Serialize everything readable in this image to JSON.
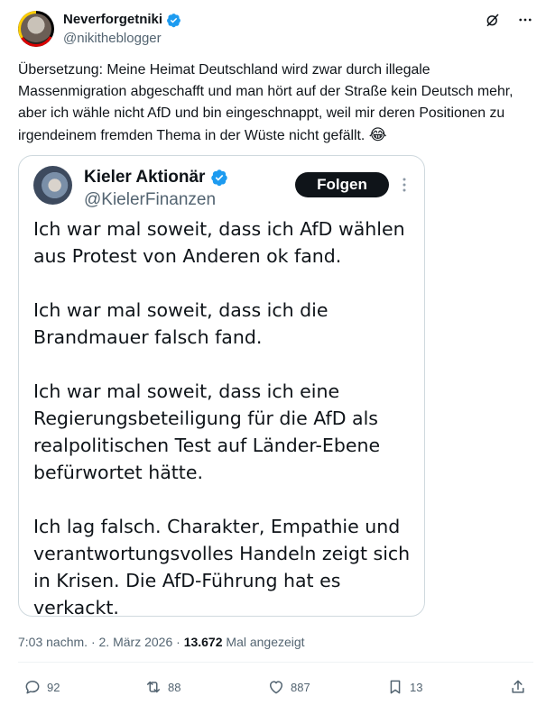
{
  "author": {
    "display_name": "Neverforgetniki",
    "handle": "@nikitheblogger",
    "verified": true
  },
  "tweet": {
    "text": "Übersetzung: Meine Heimat Deutschland wird zwar durch illegale Massenmigration abgeschafft und man hört auf der Straße kein Deutsch mehr, aber ich wähle nicht AfD und bin eingeschnappt, weil mir deren Positionen zu irgendeinem fremden Thema in der Wüste nicht gefällt.",
    "emoji": "😂"
  },
  "quoted": {
    "display_name": "Kieler Aktionär",
    "handle": "@KielerFinanzen",
    "verified": true,
    "follow_label": "Folgen",
    "paragraphs": [
      "Ich war mal soweit, dass ich AfD wählen aus Protest von Anderen ok fand.",
      "Ich war mal soweit, dass ich die Brandmauer falsch fand.",
      "Ich war mal soweit, dass ich eine Regierungsbeteiligung für die AfD als realpolitischen Test auf Länder-Ebene befürwortet hätte.",
      "Ich lag falsch. Charakter, Empathie und verantwortungsvolles Handeln zeigt sich in Krisen. Die AfD-Führung hat es verkackt."
    ]
  },
  "meta": {
    "time": "7:03 nachm.",
    "separator": "·",
    "date": "2. März 2026",
    "views_count": "13.672",
    "views_label": "Mal angezeigt"
  },
  "actions": {
    "replies": "92",
    "reposts": "88",
    "likes": "887",
    "bookmarks": "13"
  },
  "icons": [
    "verified-badge-icon",
    "grok-icon",
    "more-icon",
    "reply-icon",
    "repost-icon",
    "like-icon",
    "bookmark-icon",
    "share-icon"
  ],
  "colors": {
    "verified_blue": "#1d9bf0",
    "text_primary": "#0f1419",
    "text_secondary": "#536471",
    "border": "#cfd9de",
    "follow_button_bg": "#0f1419"
  }
}
